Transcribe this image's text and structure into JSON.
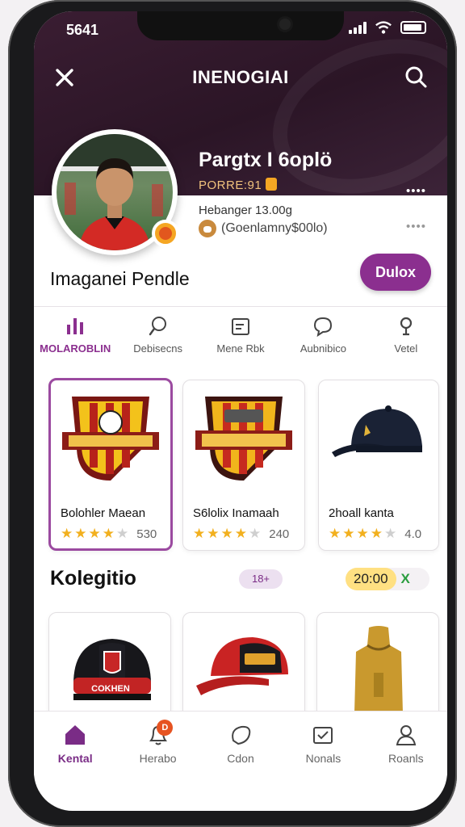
{
  "status": {
    "time": "5641"
  },
  "header": {
    "title": "INENOGIAI"
  },
  "profile": {
    "name": "Pargtx I 6oplö",
    "subtitle": "PORRE:91",
    "dots_top": "••••",
    "meta": "Hebanger 13.00g",
    "handle": "(Goenlamny$00lo)",
    "dots_bottom": "••••"
  },
  "section": {
    "title": "Imaganei Pendle",
    "follow_label": "Dulox"
  },
  "tabs": [
    {
      "label": "MOLAROBLIN",
      "icon": "chart-icon"
    },
    {
      "label": "Debisecns",
      "icon": "search-icon"
    },
    {
      "label": "Mene Rbk",
      "icon": "edit-icon"
    },
    {
      "label": "Aubnibico",
      "icon": "chat-icon"
    },
    {
      "label": "Vetel",
      "icon": "info-icon"
    }
  ],
  "products": [
    {
      "name": "Bolohler Maean",
      "rating": 4.0,
      "rating_text": "530",
      "icon": "club-crest"
    },
    {
      "name": "S6lolix Inamaah",
      "rating": 4.0,
      "rating_text": "240",
      "icon": "club-crest"
    },
    {
      "name": "2hoall kanta",
      "rating": 4.0,
      "rating_text": "4.0",
      "icon": "baseball-cap"
    }
  ],
  "collection": {
    "title": "Kolegitio",
    "pill_count": "18+",
    "pill_price": "20:00",
    "pill_mark": "X"
  },
  "collection_items": [
    {
      "label": "COKHEN",
      "icon": "black-red-cap"
    },
    {
      "label": "",
      "icon": "red-snapback-cap"
    },
    {
      "label": "",
      "icon": "mustard-apron"
    }
  ],
  "bottom_nav": [
    {
      "label": "Kental",
      "icon": "home-icon",
      "active": true
    },
    {
      "label": "Herabo",
      "icon": "bell-icon",
      "badge": "D"
    },
    {
      "label": "Cdon",
      "icon": "shield-icon"
    },
    {
      "label": "Nonals",
      "icon": "mail-icon"
    },
    {
      "label": "Roanls",
      "icon": "person-icon"
    }
  ],
  "colors": {
    "brand": "#8b2f8f",
    "hero": "#2b1526",
    "star": "#f2b01e"
  }
}
